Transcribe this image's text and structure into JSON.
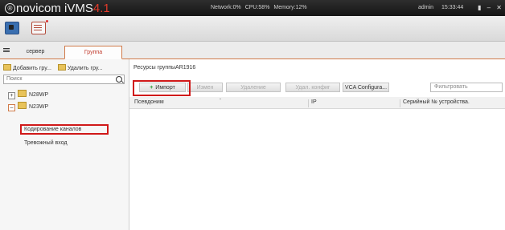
{
  "titlebar": {
    "logo_registered": "®",
    "logo_text": "novicom iVMS",
    "logo_version": "4.1",
    "network": "Network:0%",
    "cpu": "CPU:58%",
    "memory": "Memory:12%",
    "user": "admin",
    "time": "15:33:44",
    "lock_icon": "lock-icon",
    "minimize": "–",
    "close": "✕"
  },
  "toolbar": {
    "icons": [
      "live-view-icon",
      "log-icon"
    ]
  },
  "tabs": [
    {
      "label": "сервер"
    },
    {
      "label": "Группа"
    }
  ],
  "left_panel": {
    "add_group": "Добавить гру...",
    "delete_group": "Удалить гру...",
    "search_placeholder": "Поиск",
    "tree": [
      {
        "label": "N28WP",
        "expanded": false
      },
      {
        "label": "N23WP",
        "expanded": true,
        "children": [
          "Кодирование каналов",
          "Тревожный вход"
        ]
      }
    ]
  },
  "right_panel": {
    "title": "Ресурсы группыAR1916",
    "buttons": {
      "import": "Импорт",
      "edit": "Измен",
      "delete": "Удаление",
      "remote_config": "Удал. конфиг",
      "vca": "VCA Configura..."
    },
    "filter_placeholder": "Фильтровать",
    "columns": [
      "Псевдоним",
      "IP",
      "Серийный № устройства."
    ]
  },
  "colors": {
    "accent": "#d07a4a",
    "highlight": "#d01818",
    "logo_version": "#e23a2a"
  }
}
